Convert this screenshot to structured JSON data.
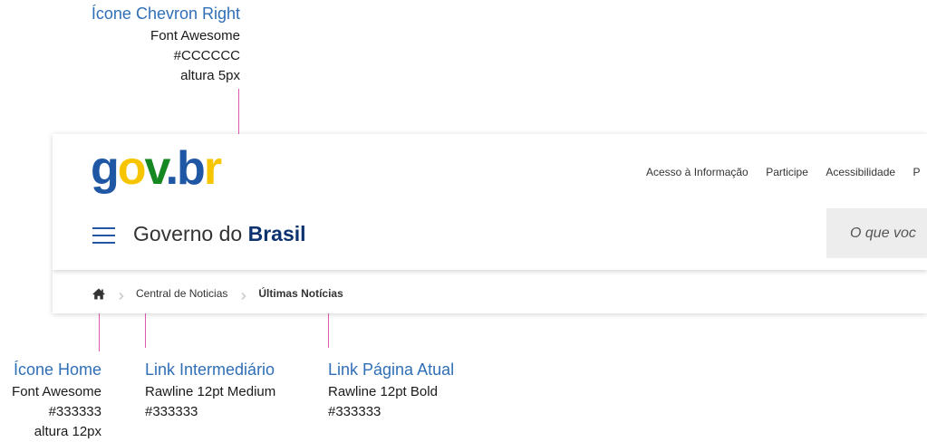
{
  "annotations": {
    "chevron": {
      "title": "Ícone Chevron Right",
      "lines": [
        "Font Awesome",
        "#CCCCCC",
        "altura 5px"
      ]
    },
    "home": {
      "title": "Ícone Home",
      "lines": [
        "Font Awesome",
        "#333333",
        "altura 12px"
      ]
    },
    "link_intermediate": {
      "title": "Link Intermediário",
      "lines": [
        "Rawline 12pt Medium",
        "#333333"
      ]
    },
    "link_current": {
      "title": "Link Página Atual",
      "lines": [
        "Rawline 12pt Bold",
        "#333333"
      ]
    }
  },
  "header": {
    "logo": {
      "g": "g",
      "o": "o",
      "v": "v",
      "dot": ".",
      "b": "b",
      "r": "r"
    },
    "top_links": [
      "Acesso à Informação",
      "Participe",
      "Acessibilidade",
      "P"
    ],
    "title_regular": "Governo do ",
    "title_bold": "Brasil",
    "search_placeholder": "O que voc"
  },
  "breadcrumb": {
    "home_icon": "home-icon",
    "separator_icon": "chevron-right-icon",
    "items": [
      "Central de Noticias",
      "Últimas Notícias"
    ]
  },
  "colors": {
    "annotation_title": "#2f6fb6",
    "guide_line": "#e05ab7",
    "text": "#333333",
    "chevron": "#CCCCCC",
    "brand_blue": "#1f57a4",
    "brand_yellow": "#f7c500",
    "brand_green": "#168821",
    "title_bold": "#0c326f"
  }
}
